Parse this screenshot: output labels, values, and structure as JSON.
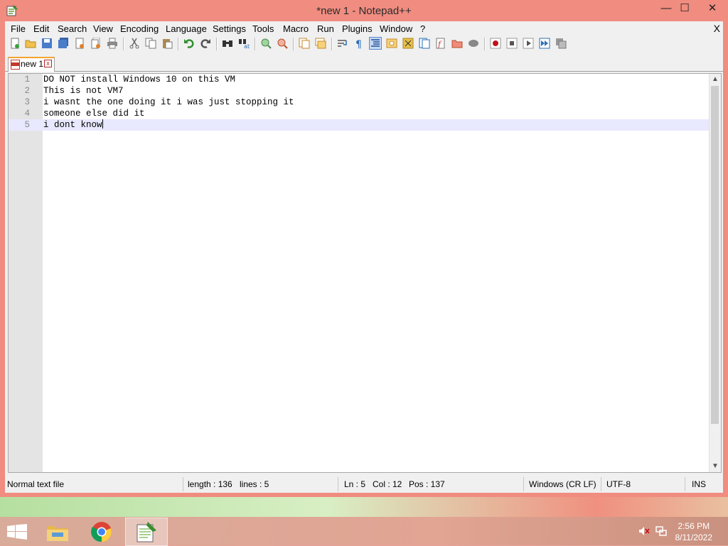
{
  "window": {
    "title": "*new 1 - Notepad++",
    "controls": {
      "minimize": "—",
      "maximize": "☐",
      "close": "✕"
    }
  },
  "menu": {
    "items": [
      "File",
      "Edit",
      "Search",
      "View",
      "Encoding",
      "Language",
      "Settings",
      "Tools",
      "Macro",
      "Run",
      "Plugins",
      "Window",
      "?"
    ],
    "close_doc": "X"
  },
  "toolbar": {
    "icons": [
      "new-file-icon",
      "open-file-icon",
      "save-icon",
      "save-all-icon",
      "close-icon",
      "close-all-icon",
      "print-icon",
      "cut-icon",
      "copy-icon",
      "paste-icon",
      "undo-icon",
      "redo-icon",
      "find-icon",
      "replace-icon",
      "zoom-in-icon",
      "zoom-out-icon",
      "sync-vertical-icon",
      "sync-horizontal-icon",
      "word-wrap-icon",
      "show-all-chars-icon",
      "indent-guide-icon",
      "user-defined-language-icon",
      "document-map-icon",
      "function-list-icon",
      "folder-as-workspace-icon",
      "monitoring-icon",
      "record-macro-icon",
      "stop-record-icon",
      "play-macro-icon",
      "run-macro-multiple-icon",
      "save-macro-icon"
    ]
  },
  "tab": {
    "label": "new 1",
    "close": "x"
  },
  "editor": {
    "lines": [
      {
        "num": "1",
        "text": "DO NOT install Windows 10 on this VM"
      },
      {
        "num": "2",
        "text": "This is not VM7"
      },
      {
        "num": "3",
        "text": "i wasnt the one doing it i was just stopping it"
      },
      {
        "num": "4",
        "text": "someone else did it"
      },
      {
        "num": "5",
        "text": "i dont know"
      }
    ],
    "current_line": 5
  },
  "status": {
    "file_type": "Normal text file",
    "length": "length : 136",
    "lines": "lines : 5",
    "ln": "Ln : 5",
    "col": "Col : 12",
    "pos": "Pos : 137",
    "eol": "Windows (CR LF)",
    "encoding": "UTF-8",
    "mode": "INS"
  },
  "taskbar": {
    "apps": [
      "file-explorer-icon",
      "chrome-icon",
      "notepad-plus-plus-icon"
    ],
    "time": "2:56 PM",
    "date": "8/11/2022"
  },
  "colors": {
    "title_bar": "#f08c80",
    "current_line": "#e8e8ff",
    "tab_accent": "#f5a430"
  }
}
